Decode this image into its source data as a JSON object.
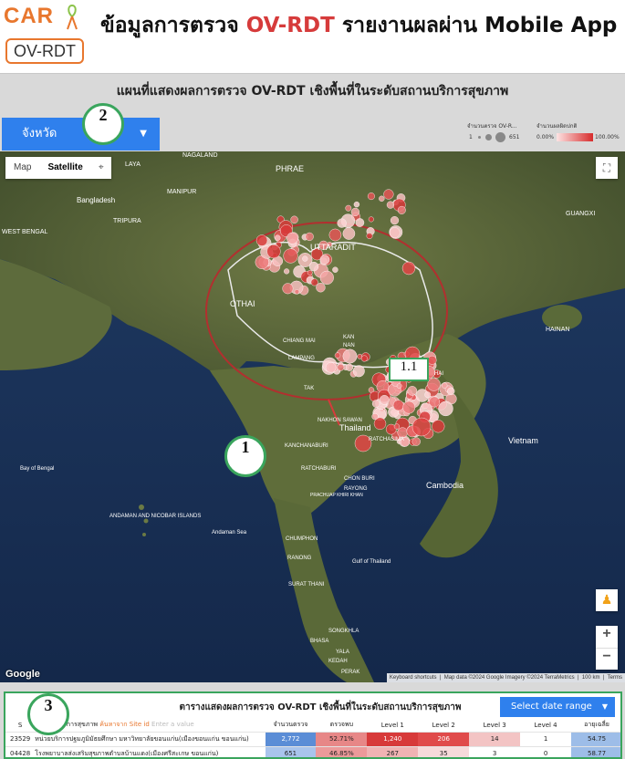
{
  "header": {
    "logo_top": "CAR",
    "logo_bottom": "OV-RDT",
    "title_prefix": "ข้อมูลการตรวจ",
    "title_accent": "OV-RDT",
    "title_suffix": "รายงานผลผ่าน Mobile App"
  },
  "report": {
    "map_title": "แผนที่แสดงผลการตรวจ OV-RDT เชิงพื้นที่ในระดับสถานบริการสุขภาพ",
    "province_select_label": "จังหวัด",
    "legend": {
      "size_label": "จำนวนตรวจ OV-R...",
      "color_label": "จำนวนผลผิดปกติ",
      "size_min": "1",
      "size_max": "651",
      "pct_min": "0.00%",
      "pct_max": "100.00%",
      "color_low": "#fde3e3",
      "color_high": "#d72c2c"
    }
  },
  "map": {
    "type_map": "Map",
    "type_satellite": "Satellite",
    "google_logo": "Google",
    "attribution": {
      "shortcuts": "Keyboard shortcuts",
      "data": "Map data ©2024 Google Imagery ©2024 TerraMetrics",
      "scale": "100 km",
      "terms": "Terms"
    },
    "zoom_in": "+",
    "zoom_out": "−",
    "places": [
      {
        "id": "nagaland",
        "name": "NAGALAND"
      },
      {
        "id": "manipur",
        "name": "MANIPUR"
      },
      {
        "id": "bangladesh",
        "name": "Bangladesh"
      },
      {
        "id": "tripura",
        "name": "TRIPURA"
      },
      {
        "id": "west-bengal",
        "name": "WEST BENGAL"
      },
      {
        "id": "phrae",
        "name": "PHRAE"
      },
      {
        "id": "uttaradit",
        "name": "UTTARADIT"
      },
      {
        "id": "guangxi",
        "name": "GUANGXI"
      },
      {
        "id": "hainan",
        "name": "HAINAN"
      },
      {
        "id": "chiang-mai",
        "name": "CHIANG MAI"
      },
      {
        "id": "lampang",
        "name": "LAMPANG"
      },
      {
        "id": "tak",
        "name": "TAK"
      },
      {
        "id": "nan",
        "name": "NAN"
      },
      {
        "id": "nakhon-sawan",
        "name": "NAKHON SAWAN"
      },
      {
        "id": "thailand",
        "name": "Thailand"
      },
      {
        "id": "kanchanaburi",
        "name": "KANCHANABURI"
      },
      {
        "id": "ratchaburi",
        "name": "RATCHABURI"
      },
      {
        "id": "chon-buri",
        "name": "CHON BURI"
      },
      {
        "id": "rayong",
        "name": "RAYONG"
      },
      {
        "id": "prachuap",
        "name": "PRACHUAP KHIRI KHAN"
      },
      {
        "id": "vietnam",
        "name": "Vietnam"
      },
      {
        "id": "cambodia",
        "name": "Cambodia"
      },
      {
        "id": "bay-of-bengal",
        "name": "Bay of Bengal"
      },
      {
        "id": "andaman-islands",
        "name": "ANDAMAN AND NICOBAR ISLANDS"
      },
      {
        "id": "andaman-sea",
        "name": "Andaman Sea"
      },
      {
        "id": "chumphon",
        "name": "CHUMPHON"
      },
      {
        "id": "ranong",
        "name": "RANONG"
      },
      {
        "id": "surat-thani",
        "name": "SURAT THANI"
      },
      {
        "id": "gulf-of-thailand",
        "name": "Gulf of Thailand"
      },
      {
        "id": "songkhla",
        "name": "SONGKHLA"
      },
      {
        "id": "yala",
        "name": "YALA"
      },
      {
        "id": "perak",
        "name": "PERAK"
      },
      {
        "id": "kedah",
        "name": "KEDAH"
      },
      {
        "id": "bhasa",
        "name": "BHASA"
      },
      {
        "id": "laya",
        "name": "LAYA"
      },
      {
        "id": "hai-lao",
        "name": "HAI"
      },
      {
        "id": "ratchasima",
        "name": "RATCHASIMA"
      },
      {
        "id": "kan",
        "name": "KAN"
      },
      {
        "id": "othai",
        "name": "OTHAI"
      }
    ],
    "callout_1": "1",
    "callout_1_1": "1.1",
    "callout_2": "2",
    "callout_3": "3"
  },
  "table": {
    "title": "ตารางแสดงผลการตรวจ OV-RDT เชิงพื้นที่ในระดับสถานบริการสุขภาพ",
    "date_range_label": "Select date range",
    "filter_label": "ค้นหาจาก Site id",
    "filter_placeholder": "Enter a value",
    "headers": [
      "S",
      "ชื่อหน่วยบริการสุขภาพ",
      "",
      "จำนวนตรวจ",
      "ตรวจพบ",
      "Level 1",
      "Level 2",
      "Level 3",
      "Level 4",
      "อายุเฉลี่ย"
    ],
    "rows": [
      {
        "code": "23529",
        "name": "หน่วยบริการปฐมภูมิมัธยศึกษา มหาวิทยาลัยขอนแก่น(เมืองขอนแก่น ขอนแก่น)",
        "count": "2,772",
        "pct": "52.71%",
        "l1": "1,240",
        "l2": "206",
        "l3": "14",
        "l4": "1",
        "age": "54.75"
      },
      {
        "code": "04428",
        "name": "โรงพยาบาลส่งเสริมสุขภาพตำบลบ้านแดง(เมืองศรีสะเกษ ขอนแก่น)",
        "count": "651",
        "pct": "46.85%",
        "l1": "267",
        "l2": "35",
        "l3": "3",
        "l4": "0",
        "age": "58.77"
      }
    ]
  }
}
